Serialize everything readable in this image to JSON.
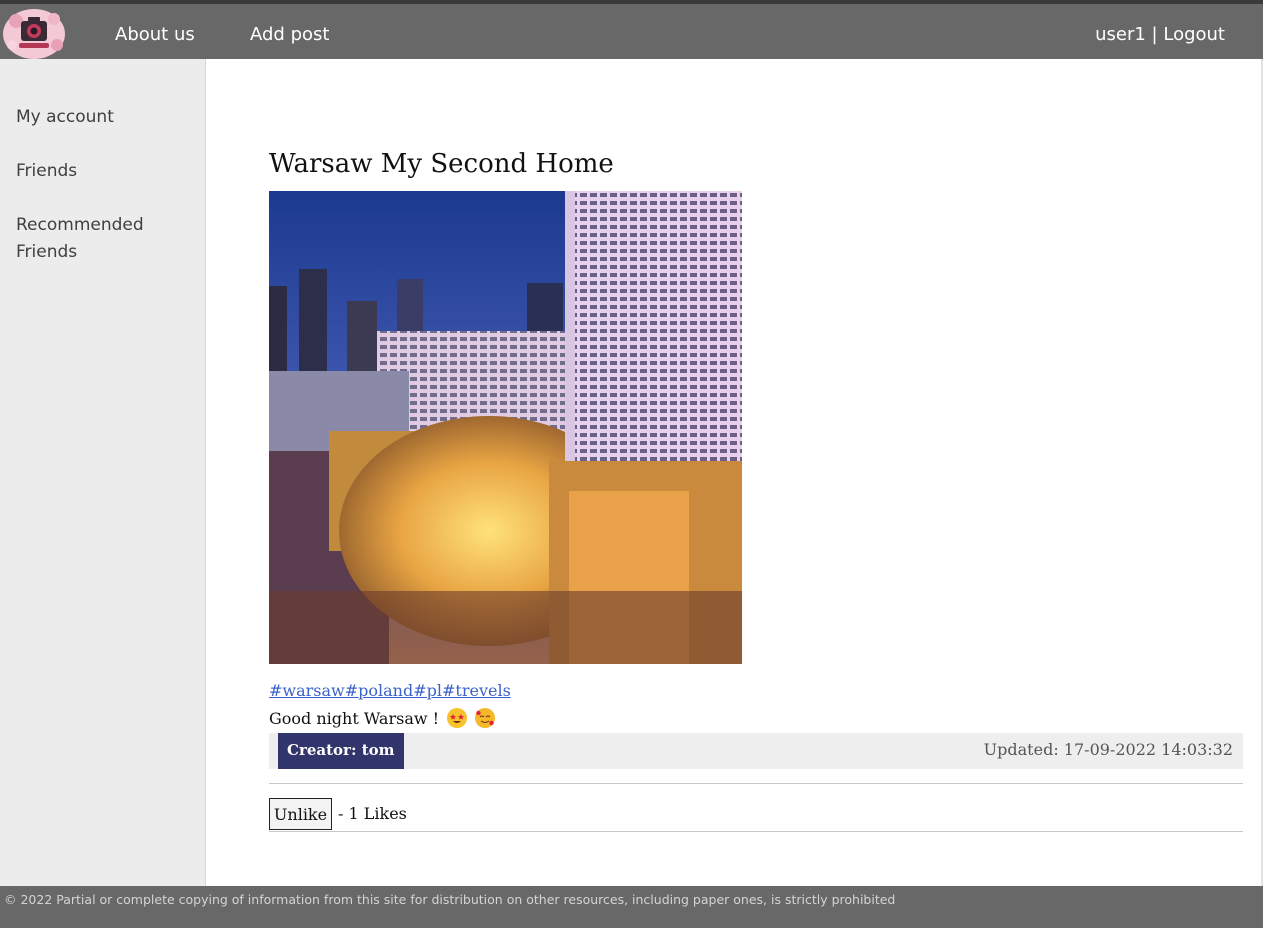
{
  "header": {
    "logo_icon": "camera-logo-icon",
    "nav": [
      {
        "label": "About us"
      },
      {
        "label": "Add post"
      }
    ],
    "user": "user1",
    "separator": "|",
    "logout": "Logout"
  },
  "sidebar": {
    "items": [
      {
        "label": "My account"
      },
      {
        "label": "Friends"
      },
      {
        "label": "Recommended Friends"
      }
    ]
  },
  "post": {
    "title": "Warsaw My Second Home",
    "image_icon": "warsaw-city-photo",
    "tags": "#warsaw#poland#pl#trevels",
    "caption": "Good night Warsaw !",
    "emojis": [
      "star-struck-emoji",
      "smiling-face-with-hearts-emoji"
    ],
    "creator": "Creator: tom",
    "updated": "Updated: 17-09-2022 14:03:32",
    "like_button": "Unlike",
    "likes_text": "- 1 Likes"
  },
  "footer": {
    "text": "© 2022 Partial or complete copying of information from this site for distribution on other resources, including paper ones, is strictly prohibited"
  },
  "colors": {
    "navbar": "#686868",
    "sidebar": "#ececec",
    "creator_badge": "#32356b",
    "link": "#3b62c9",
    "meta_bar": "#eeeeee"
  }
}
